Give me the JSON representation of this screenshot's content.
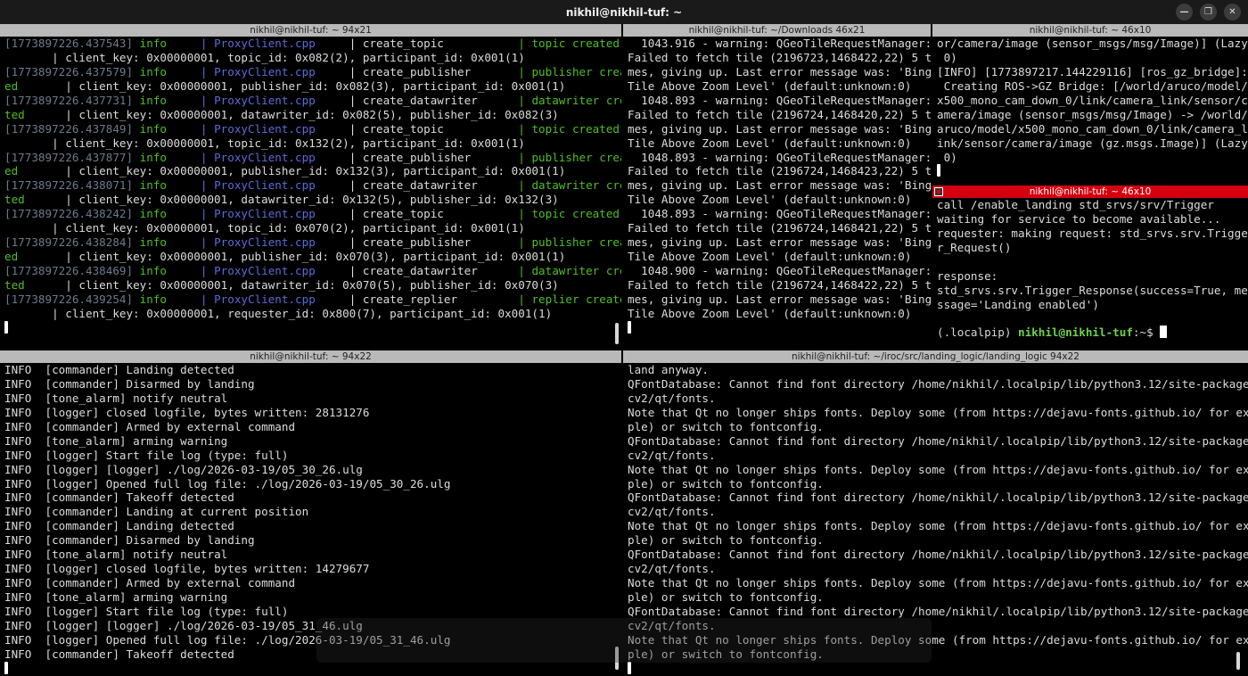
{
  "window": {
    "title": "nikhil@nikhil-tuf: ~"
  },
  "panes": {
    "top_left": {
      "title": "nikhil@nikhil-tuf: ~ 94x21",
      "lines": [
        [
          [
            "c-ts",
            "[1773897226.437543] "
          ],
          [
            "c-green",
            "info     "
          ],
          [
            "c-blue",
            "| ProxyClient.cpp     "
          ],
          [
            "c-white",
            "| create_topic           "
          ],
          [
            "c-green",
            "| topic created"
          ]
        ],
        [
          [
            "c-white",
            "       | client_key: 0x00000001, topic_id: 0x082(2), participant_id: 0x001(1)"
          ]
        ],
        [
          [
            "c-ts",
            "[1773897226.437579] "
          ],
          [
            "c-green",
            "info     "
          ],
          [
            "c-blue",
            "| ProxyClient.cpp     "
          ],
          [
            "c-white",
            "| create_publisher       "
          ],
          [
            "c-green",
            "| publisher creat"
          ]
        ],
        [
          [
            "c-green",
            "ed"
          ],
          [
            "c-white",
            "       | client_key: 0x00000001, publisher_id: 0x082(3), participant_id: 0x001(1)"
          ]
        ],
        [
          [
            "c-ts",
            "[1773897226.437731] "
          ],
          [
            "c-green",
            "info     "
          ],
          [
            "c-blue",
            "| ProxyClient.cpp     "
          ],
          [
            "c-white",
            "| create_datawriter      "
          ],
          [
            "c-green",
            "| datawriter crea"
          ]
        ],
        [
          [
            "c-green",
            "ted"
          ],
          [
            "c-white",
            "      | client_key: 0x00000001, datawriter_id: 0x082(5), publisher_id: 0x082(3)"
          ]
        ],
        [
          [
            "c-ts",
            "[1773897226.437849] "
          ],
          [
            "c-green",
            "info     "
          ],
          [
            "c-blue",
            "| ProxyClient.cpp     "
          ],
          [
            "c-white",
            "| create_topic           "
          ],
          [
            "c-green",
            "| topic created"
          ]
        ],
        [
          [
            "c-white",
            "       | client_key: 0x00000001, topic_id: 0x132(2), participant_id: 0x001(1)"
          ]
        ],
        [
          [
            "c-ts",
            "[1773897226.437877] "
          ],
          [
            "c-green",
            "info     "
          ],
          [
            "c-blue",
            "| ProxyClient.cpp     "
          ],
          [
            "c-white",
            "| create_publisher       "
          ],
          [
            "c-green",
            "| publisher creat"
          ]
        ],
        [
          [
            "c-green",
            "ed"
          ],
          [
            "c-white",
            "       | client_key: 0x00000001, publisher_id: 0x132(3), participant_id: 0x001(1)"
          ]
        ],
        [
          [
            "c-ts",
            "[1773897226.438071] "
          ],
          [
            "c-green",
            "info     "
          ],
          [
            "c-blue",
            "| ProxyClient.cpp     "
          ],
          [
            "c-white",
            "| create_datawriter      "
          ],
          [
            "c-green",
            "| datawriter crea"
          ]
        ],
        [
          [
            "c-green",
            "ted"
          ],
          [
            "c-white",
            "      | client_key: 0x00000001, datawriter_id: 0x132(5), publisher_id: 0x132(3)"
          ]
        ],
        [
          [
            "c-ts",
            "[1773897226.438242] "
          ],
          [
            "c-green",
            "info     "
          ],
          [
            "c-blue",
            "| ProxyClient.cpp     "
          ],
          [
            "c-white",
            "| create_topic           "
          ],
          [
            "c-green",
            "| topic created"
          ]
        ],
        [
          [
            "c-white",
            "       | client_key: 0x00000001, topic_id: 0x070(2), participant_id: 0x001(1)"
          ]
        ],
        [
          [
            "c-ts",
            "[1773897226.438284] "
          ],
          [
            "c-green",
            "info     "
          ],
          [
            "c-blue",
            "| ProxyClient.cpp     "
          ],
          [
            "c-white",
            "| create_publisher       "
          ],
          [
            "c-green",
            "| publisher creat"
          ]
        ],
        [
          [
            "c-green",
            "ed"
          ],
          [
            "c-white",
            "       | client_key: 0x00000001, publisher_id: 0x070(3), participant_id: 0x001(1)"
          ]
        ],
        [
          [
            "c-ts",
            "[1773897226.438469] "
          ],
          [
            "c-green",
            "info     "
          ],
          [
            "c-blue",
            "| ProxyClient.cpp     "
          ],
          [
            "c-white",
            "| create_datawriter      "
          ],
          [
            "c-green",
            "| datawriter crea"
          ]
        ],
        [
          [
            "c-green",
            "ted"
          ],
          [
            "c-white",
            "      | client_key: 0x00000001, datawriter_id: 0x070(5), publisher_id: 0x070(3)"
          ]
        ],
        [
          [
            "c-ts",
            "[1773897226.439254] "
          ],
          [
            "c-green",
            "info     "
          ],
          [
            "c-blue",
            "| ProxyClient.cpp     "
          ],
          [
            "c-white",
            "| create_replier         "
          ],
          [
            "c-green",
            "| replier created"
          ]
        ],
        [
          [
            "c-white",
            "       | client_key: 0x00000001, requester_id: 0x800(7), participant_id: 0x001(1)"
          ]
        ]
      ]
    },
    "top_mid": {
      "title": "nikhil@nikhil-tuf: ~/Downloads 46x21",
      "lines": [
        "  1043.916 - warning: QGeoTileRequestManager:",
        "Failed to fetch tile (2196723,1468422,22) 5 ti",
        "mes, giving up. Last error message was: 'Bing",
        "Tile Above Zoom Level' (default:unknown:0)",
        "  1048.893 - warning: QGeoTileRequestManager:",
        "Failed to fetch tile (2196724,1468420,22) 5 ti",
        "mes, giving up. Last error message was: 'Bing",
        "Tile Above Zoom Level' (default:unknown:0)",
        "  1048.893 - warning: QGeoTileRequestManager:",
        "Failed to fetch tile (2196724,1468423,22) 5 ti",
        "mes, giving up. Last error message was: 'Bing",
        "Tile Above Zoom Level' (default:unknown:0)",
        "  1048.893 - warning: QGeoTileRequestManager:",
        "Failed to fetch tile (2196724,1468421,22) 5 ti",
        "mes, giving up. Last error message was: 'Bing",
        "Tile Above Zoom Level' (default:unknown:0)",
        "  1048.900 - warning: QGeoTileRequestManager:",
        "Failed to fetch tile (2196724,1468422,22) 5 ti",
        "mes, giving up. Last error message was: 'Bing",
        "Tile Above Zoom Level' (default:unknown:0)"
      ]
    },
    "top_right_a": {
      "title": "nikhil@nikhil-tuf: ~ 46x10",
      "lines": [
        "or/camera/image (sensor_msgs/msg/Image)] (Lazy",
        " 0)",
        "[INFO] [1773897217.144229116] [ros_gz_bridge]:",
        " Creating ROS->GZ Bridge: [/world/aruco/model/",
        "x500_mono_cam_down_0/link/camera_link/sensor/c",
        "amera/image (sensor_msgs/msg/Image) -> /world/",
        "aruco/model/x500_mono_cam_down_0/link/camera_l",
        "ink/sensor/camera/image (gz.msgs.Image)] (Lazy",
        " 0)"
      ]
    },
    "top_right_b": {
      "title": "nikhil@nikhil-tuf: ~ 46x10",
      "lines": [
        "call /enable_landing std_srvs/srv/Trigger",
        "waiting for service to become available...",
        "requester: making request: std_srvs.srv.Trigge",
        "r_Request()",
        "",
        "response:",
        "std_srvs.srv.Trigger_Response(success=True, me",
        "ssage='Landing enabled')",
        ""
      ],
      "prompt_env": "(.localpip) ",
      "prompt_user": "nikhil@nikhil-tuf",
      "prompt_path": ":~$ "
    },
    "bottom_left": {
      "title": "nikhil@nikhil-tuf: ~ 94x22",
      "lines": [
        [
          "INFO  ",
          "[commander] ",
          "Landing detected"
        ],
        [
          "INFO  ",
          "[commander] ",
          "Disarmed by landing"
        ],
        [
          "INFO  ",
          "[tone_alarm] ",
          "notify neutral"
        ],
        [
          "INFO  ",
          "[logger] ",
          "closed logfile, bytes written: 28131276"
        ],
        [
          "INFO  ",
          "[commander] ",
          "Armed by external command"
        ],
        [
          "INFO  ",
          "[tone_alarm] ",
          "arming warning"
        ],
        [
          "INFO  ",
          "[logger] ",
          "Start file log (type: full)"
        ],
        [
          "INFO  ",
          "[logger] ",
          "[logger] ./log/2026-03-19/05_30_26.ulg"
        ],
        [
          "INFO  ",
          "[logger] ",
          "Opened full log file: ./log/2026-03-19/05_30_26.ulg"
        ],
        [
          "INFO  ",
          "[commander] ",
          "Takeoff detected"
        ],
        [
          "INFO  ",
          "[commander] ",
          "Landing at current position"
        ],
        [
          "INFO  ",
          "[commander] ",
          "Landing detected"
        ],
        [
          "INFO  ",
          "[commander] ",
          "Disarmed by landing"
        ],
        [
          "INFO  ",
          "[tone_alarm] ",
          "notify neutral"
        ],
        [
          "INFO  ",
          "[logger] ",
          "closed logfile, bytes written: 14279677"
        ],
        [
          "INFO  ",
          "[commander] ",
          "Armed by external command"
        ],
        [
          "INFO  ",
          "[tone_alarm] ",
          "arming warning"
        ],
        [
          "INFO  ",
          "[logger] ",
          "Start file log (type: full)"
        ],
        [
          "INFO  ",
          "[logger] ",
          "[logger] ./log/2026-03-19/05_31_46.ulg"
        ],
        [
          "INFO  ",
          "[logger] ",
          "Opened full log file: ./log/2026-03-19/05_31_46.ulg"
        ],
        [
          "INFO  ",
          "[commander] ",
          "Takeoff detected"
        ]
      ]
    },
    "bottom_right": {
      "title": "nikhil@nikhil-tuf: ~/iroc/src/landing_logic/landing_logic 94x22",
      "lines": [
        "land anyway.",
        "QFontDatabase: Cannot find font directory /home/nikhil/.localpip/lib/python3.12/site-packages/",
        "cv2/qt/fonts.",
        "Note that Qt no longer ships fonts. Deploy some (from https://dejavu-fonts.github.io/ for exam",
        "ple) or switch to fontconfig.",
        "QFontDatabase: Cannot find font directory /home/nikhil/.localpip/lib/python3.12/site-packages/",
        "cv2/qt/fonts.",
        "Note that Qt no longer ships fonts. Deploy some (from https://dejavu-fonts.github.io/ for exam",
        "ple) or switch to fontconfig.",
        "QFontDatabase: Cannot find font directory /home/nikhil/.localpip/lib/python3.12/site-packages/",
        "cv2/qt/fonts.",
        "Note that Qt no longer ships fonts. Deploy some (from https://dejavu-fonts.github.io/ for exam",
        "ple) or switch to fontconfig.",
        "QFontDatabase: Cannot find font directory /home/nikhil/.localpip/lib/python3.12/site-packages/",
        "cv2/qt/fonts.",
        "Note that Qt no longer ships fonts. Deploy some (from https://dejavu-fonts.github.io/ for exam",
        "ple) or switch to fontconfig.",
        "QFontDatabase: Cannot find font directory /home/nikhil/.localpip/lib/python3.12/site-packages/",
        "cv2/qt/fonts.",
        "Note that Qt no longer ships fonts. Deploy some (from https://dejavu-fonts.github.io/ for exam",
        "ple) or switch to fontconfig."
      ]
    }
  },
  "icons": {
    "minimize": "minimize-icon",
    "maximize": "maximize-icon",
    "close": "close-icon"
  },
  "colors": {
    "active_title": "#d4000f",
    "prompt": "#6fd24a",
    "info_green": "#4fbf26",
    "source_blue": "#5c6bd6"
  }
}
